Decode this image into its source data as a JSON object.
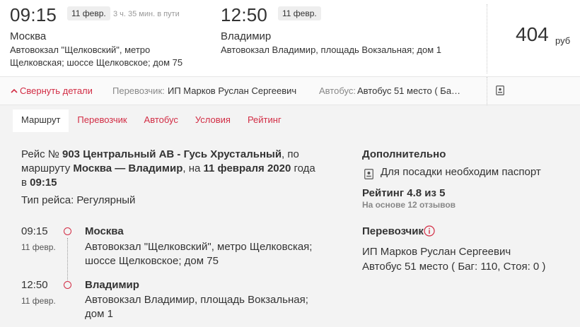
{
  "departure": {
    "time": "09:15",
    "date": "11 февр.",
    "duration": "3 ч. 35 мин. в пути",
    "city": "Москва",
    "address_line1": "Автовокзал \"Щелковский\", метро",
    "address_line2": "Щелковская; шоссе Щелковское; дом 75"
  },
  "arrival": {
    "time": "12:50",
    "date": "11 февр.",
    "city": "Владимир",
    "address_line1": "Автовокзал Владимир, площадь Вокзальная; дом 1"
  },
  "price": {
    "amount": "404",
    "currency": "руб"
  },
  "details_bar": {
    "collapse_label": "Свернуть детали",
    "carrier_label": "Перевозчик:",
    "carrier_value": "ИП Марков Руслан Сергеевич",
    "bus_label": "Автобус:",
    "bus_value": "Автобус 51 место ( Ба…"
  },
  "tabs": [
    {
      "label": "Маршрут",
      "active": true
    },
    {
      "label": "Перевозчик",
      "active": false
    },
    {
      "label": "Автобус",
      "active": false
    },
    {
      "label": "Условия",
      "active": false
    },
    {
      "label": "Рейтинг",
      "active": false
    }
  ],
  "route": {
    "desc_prefix": "Рейс № ",
    "trip_number": "903 Центральный АВ - Гусь Хрустальный",
    "desc_mid1": ", по маршруту ",
    "route_name": "Москва — Владимир",
    "desc_mid2": ", на ",
    "trip_date": "11 февраля 2020",
    "desc_mid3": " года в ",
    "trip_time": "09:15",
    "trip_type": "Тип рейса: Регулярный",
    "stops": [
      {
        "time": "09:15",
        "date": "11 февр.",
        "city": "Москва",
        "address": "Автовокзал \"Щелковский\", метро Щелковская; шоссе Щелковское; дом 75"
      },
      {
        "time": "12:50",
        "date": "11 февр.",
        "city": "Владимир",
        "address": "Автовокзал Владимир, площадь Вокзальная; дом 1"
      }
    ]
  },
  "sidebar": {
    "extra_title": "Дополнительно",
    "passport_note": "Для посадки необходим паспорт",
    "rating_title": "Рейтинг 4.8 из 5",
    "rating_sub": "На основе 12 отзывов",
    "carrier_title": "Перевозчик",
    "carrier_name": "ИП Марков Руслан Сергеевич",
    "bus_info": "Автобус 51 место ( Баг: 110, Стоя: 0 )"
  },
  "colors": {
    "accent": "#d22c44",
    "panel_bg": "#f3f3f3"
  },
  "icons": [
    "chevron-up-icon",
    "passport-icon",
    "info-icon"
  ]
}
